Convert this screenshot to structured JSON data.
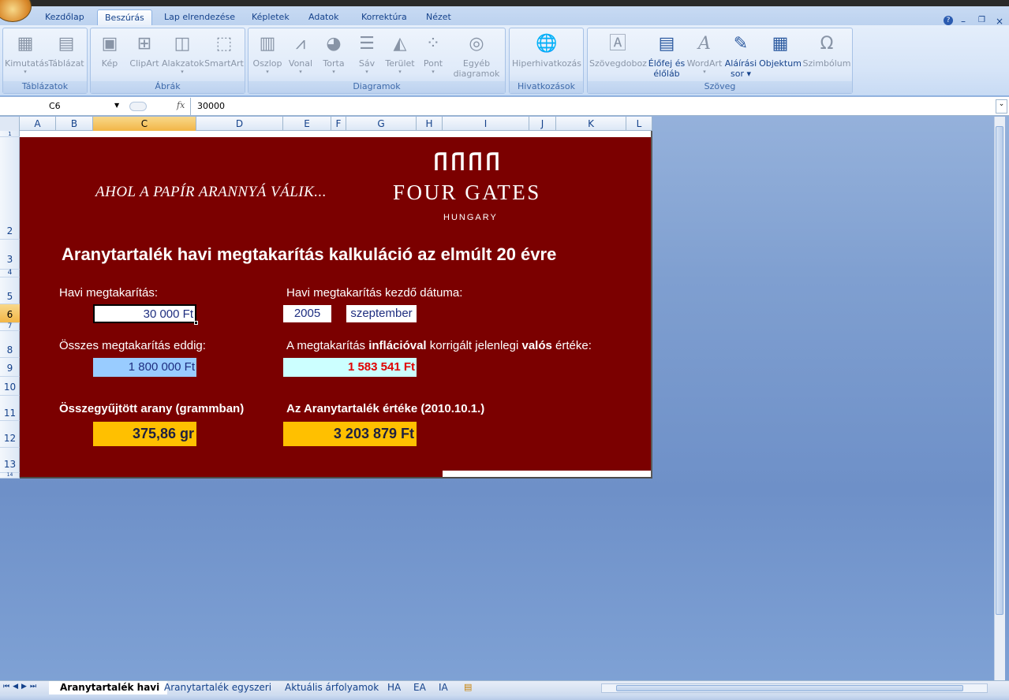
{
  "window": {
    "help_icon": "?",
    "min_icon": "–",
    "restore_icon": "❐",
    "close_icon": "×"
  },
  "tabs": [
    "Kezdőlap",
    "Beszúrás",
    "Lap elrendezése",
    "Képletek",
    "Adatok",
    "Korrektúra",
    "Nézet"
  ],
  "ribbon": {
    "groups": {
      "tablazatok": "Táblázatok",
      "abrak": "Ábrák",
      "diagramok": "Diagramok",
      "hivatkozasok": "Hivatkozások",
      "szoveg": "Szöveg"
    },
    "buttons": {
      "kimutatas": "Kimutatás",
      "tablazat": "Táblázat",
      "kep": "Kép",
      "clipart": "ClipArt",
      "alakzatok": "Alakzatok",
      "smartart": "SmartArt",
      "oszlop": "Oszlop",
      "vonal": "Vonal",
      "torta": "Torta",
      "sav": "Sáv",
      "terulet": "Terület",
      "pont": "Pont",
      "egyeb1": "Egyéb",
      "egyeb2": "diagramok",
      "hiper": "Hiperhivatkozás",
      "szovegdoboz": "Szövegdoboz",
      "elofej1": "Élőfej és",
      "elofej2": "élőláb",
      "wordart": "WordArt",
      "alairas1": "Aláírási",
      "alairas2": "sor",
      "objektum": "Objektum",
      "szimbolum": "Szimbólum"
    }
  },
  "formula_bar": {
    "name_box": "C6",
    "fx": "fx",
    "formula": "30000"
  },
  "columns": [
    "A",
    "B",
    "C",
    "D",
    "E",
    "F",
    "G",
    "H",
    "I",
    "J",
    "K",
    "L"
  ],
  "rows": [
    "1",
    "2",
    "3",
    "4",
    "5",
    "6",
    "7",
    "8",
    "9",
    "10",
    "11",
    "12",
    "13",
    "14"
  ],
  "sheet": {
    "slogan": "AHOL A PAPÍR ARANNYÁ VÁLIK...",
    "logo_main": "FOUR GATES",
    "logo_sub": "HUNGARY",
    "title": "Aranytartalék havi megtakarítás kalkuláció az elmúlt 20 évre",
    "label_monthly": "Havi megtakarítás:",
    "monthly_value": "30 000 Ft",
    "label_start": "Havi megtakarítás kezdő dátuma:",
    "start_year": "2005",
    "start_month": "szeptember",
    "label_total": "Összes megtakarítás eddig:",
    "total_value": "1 800 000 Ft",
    "label_real_a": "A megtakarítás ",
    "label_real_b": "inflációval",
    "label_real_c": " korrigált jelenlegi ",
    "label_real_d": "valós",
    "label_real_e": " értéke:",
    "real_value": "1 583 541 Ft",
    "label_gold": "Összegyűjtött arany (grammban)",
    "gold_value": "375,86 gr",
    "label_reserve": "Az Aranytartalék értéke (2010.10.1.)",
    "reserve_value": "3 203 879 Ft"
  },
  "sheet_tabs": [
    "Aranytartalék havi",
    "Aranytartalék egyszeri",
    "Aktuális árfolyamok",
    "HA",
    "EA",
    "IA"
  ]
}
